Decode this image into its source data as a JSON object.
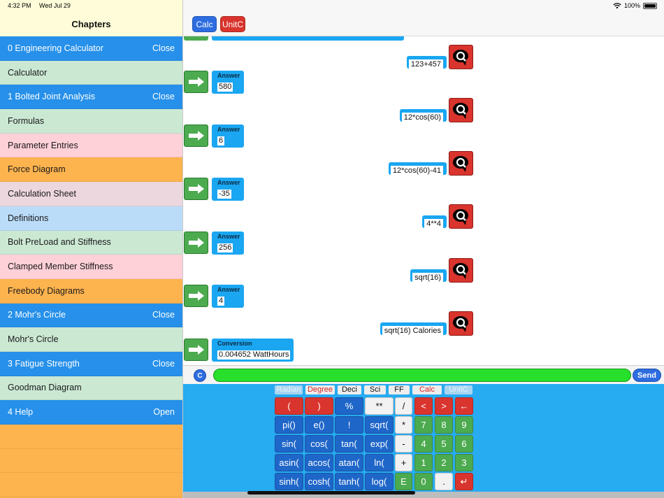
{
  "status": {
    "time": "4:32 PM",
    "date": "Wed Jul 29",
    "battery": "100%"
  },
  "sidebar": {
    "title": "Chapters",
    "items": [
      {
        "label": "0 Engineering Calculator",
        "action": "Close",
        "style": "chapter"
      },
      {
        "label": "Calculator",
        "action": "",
        "style": "green"
      },
      {
        "label": "1 Bolted Joint Analysis",
        "action": "Close",
        "style": "chapter"
      },
      {
        "label": "Formulas",
        "action": "",
        "style": "green"
      },
      {
        "label": "Parameter Entries",
        "action": "",
        "style": "pink"
      },
      {
        "label": "Force Diagram",
        "action": "",
        "style": "orange"
      },
      {
        "label": "Calculation Sheet",
        "action": "",
        "style": "mauve"
      },
      {
        "label": "Definitions",
        "action": "",
        "style": "blue"
      },
      {
        "label": "Bolt PreLoad and Stiffness",
        "action": "",
        "style": "green"
      },
      {
        "label": "Clamped Member Stiffness",
        "action": "",
        "style": "pink"
      },
      {
        "label": "Freebody Diagrams",
        "action": "",
        "style": "orange"
      },
      {
        "label": "2 Mohr's Circle",
        "action": "Close",
        "style": "chapter"
      },
      {
        "label": "Mohr's Circle",
        "action": "",
        "style": "green"
      },
      {
        "label": "3 Fatigue Strength",
        "action": "Close",
        "style": "chapter"
      },
      {
        "label": "Goodman Diagram",
        "action": "",
        "style": "green"
      },
      {
        "label": "4 Help",
        "action": "Open",
        "style": "chapter"
      }
    ]
  },
  "toolbar": {
    "calc": "Calc",
    "unitc": "UnitC"
  },
  "chat": {
    "entries": [
      {
        "q": "123+457",
        "a_header": "Answer",
        "a": "580"
      },
      {
        "q": "12*cos(60)",
        "a_header": "Answer",
        "a": "6"
      },
      {
        "q": "12*cos(60)-41",
        "a_header": "Answer",
        "a": "-35"
      },
      {
        "q": "4**4",
        "a_header": "Answer",
        "a": "256"
      },
      {
        "q": "sqrt(16)",
        "a_header": "Answer",
        "a": "4"
      },
      {
        "q": "sqrt(16) Calories",
        "a_header": "Conversion",
        "a": "0.004652 WattHours"
      }
    ]
  },
  "input": {
    "clear": "C",
    "send": "Send",
    "value": ""
  },
  "keypad": {
    "modes": [
      "Radian",
      "Degree",
      "Deci",
      "Sci",
      "FF",
      "Calc",
      "UnitC"
    ],
    "rows": [
      [
        "(",
        ")",
        "%",
        "**",
        "/",
        "<",
        ">",
        "←"
      ],
      [
        "pi()",
        "e()",
        "!",
        "sqrt(",
        "*",
        "7",
        "8",
        "9"
      ],
      [
        "sin(",
        "cos(",
        "tan(",
        "exp(",
        "-",
        "4",
        "5",
        "6"
      ],
      [
        "asin(",
        "acos(",
        "atan(",
        "ln(",
        "+",
        "1",
        "2",
        "3"
      ],
      [
        "sinh(",
        "cosh(",
        "tanh(",
        "log(",
        "E",
        "0",
        ".",
        "↵"
      ]
    ]
  },
  "colors": {
    "chapter": "#2690ea",
    "red": "#d9342d",
    "green": "#4caa4f",
    "keypad_bg": "#27abf1"
  }
}
